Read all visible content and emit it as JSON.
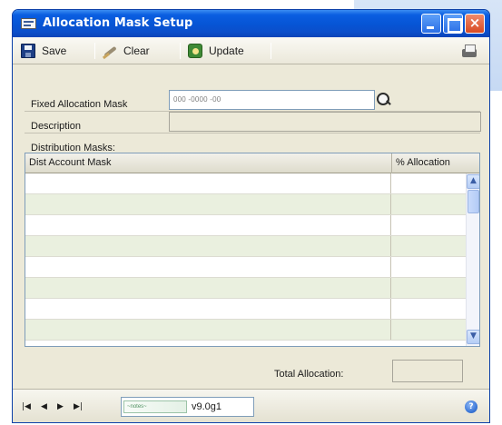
{
  "window": {
    "title": "Allocation Mask Setup",
    "close_glyph": "×"
  },
  "toolbar": {
    "save_label": "Save",
    "clear_label": "Clear",
    "update_label": "Update"
  },
  "form": {
    "fixed_allocation_mask_label": "Fixed Allocation Mask",
    "fixed_allocation_mask_value": "000 -0000 -00",
    "description_label": "Description",
    "description_value": "",
    "distribution_masks_label": "Distribution Masks:"
  },
  "grid": {
    "columns": [
      "Dist Account Mask",
      "% Allocation"
    ],
    "rows": [
      {
        "account_mask": "",
        "allocation": ""
      },
      {
        "account_mask": "",
        "allocation": ""
      },
      {
        "account_mask": "",
        "allocation": ""
      },
      {
        "account_mask": "",
        "allocation": ""
      },
      {
        "account_mask": "",
        "allocation": ""
      },
      {
        "account_mask": "",
        "allocation": ""
      },
      {
        "account_mask": "",
        "allocation": ""
      },
      {
        "account_mask": "",
        "allocation": ""
      }
    ],
    "scroll_up_glyph": "▲",
    "scroll_down_glyph": "▼"
  },
  "totals": {
    "total_allocation_label": "Total Allocation:",
    "total_allocation_value": ""
  },
  "statusbar": {
    "nav_first": "|◀",
    "nav_prev": "◀",
    "nav_next": "▶",
    "nav_last": "▶|",
    "note_logo_text": "~notes~",
    "version": "v9.0g1",
    "help_glyph": "?"
  },
  "icons": [
    "window-icon",
    "save-icon",
    "clear-icon",
    "update-icon",
    "print-icon",
    "lookup-icon",
    "help-icon"
  ],
  "colors": {
    "titlebar": "#0654d4",
    "window_bg": "#ece9d8",
    "grid_alt_row": "#eaf0df",
    "close_button": "#d84a22"
  }
}
